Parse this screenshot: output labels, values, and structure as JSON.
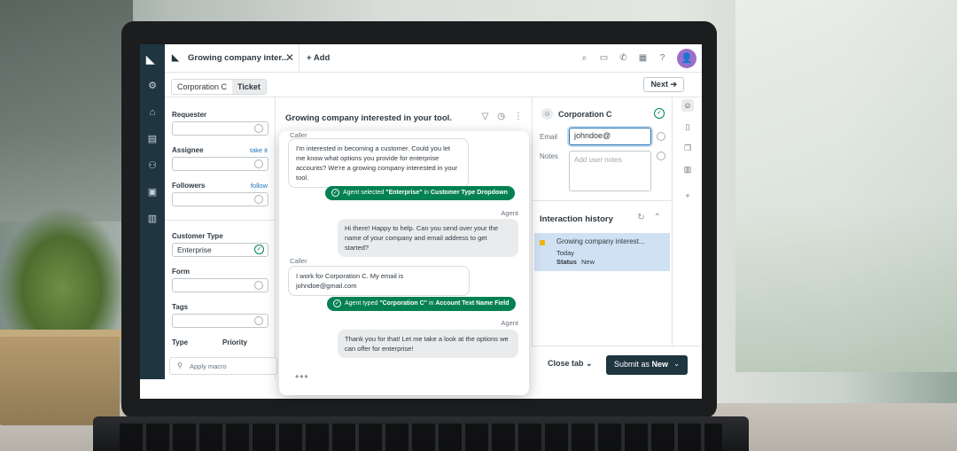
{
  "top": {
    "tab_title": "Growing company inter...",
    "add_label": "+ Add",
    "avatar_glyph": "👤"
  },
  "sub": {
    "crumbs": [
      "Corporation C",
      "Ticket"
    ],
    "next_label": "Next ➔"
  },
  "props": {
    "requester_label": "Requester",
    "assignee_label": "Assignee",
    "assignee_link": "take it",
    "followers_label": "Followers",
    "followers_link": "follow",
    "customer_type_label": "Customer Type",
    "customer_type_value": "Enterprise",
    "form_label": "Form",
    "tags_label": "Tags",
    "type_label": "Type",
    "priority_label": "Priority",
    "macro_label": "Apply macro"
  },
  "conversation": {
    "title": "Growing company interested in your tool.",
    "messages": [
      {
        "who": "Caller",
        "text": "I'm interested in becoming a customer. Could you let me know what options you provide for enterprise accounts? We're a growing company interested in your tool."
      },
      {
        "pill_prefix": "Agent selected ",
        "pill_value": "\"Enterprise\"",
        "pill_mid": " in ",
        "pill_field": "Customer Type Dropdown"
      },
      {
        "who": "Agent",
        "text": "Hi there! Happy to help. Can you send over your the name of your company and email address to get started?"
      },
      {
        "who": "Caller",
        "text": "I work for Corporation C. My email is johndoe@gmail.com"
      },
      {
        "pill_prefix": "Agent typed ",
        "pill_value": "\"Corporation C\"",
        "pill_mid": " in ",
        "pill_field": "Account Text Name Field"
      },
      {
        "who": "Agent",
        "text": "Thank you for that! Let me take a look at the options we can offer for enterprise!"
      }
    ],
    "typing": "•••"
  },
  "customer": {
    "name": "Corporation C",
    "email_label": "Email",
    "email_value": "johndoe@",
    "notes_label": "Notes",
    "notes_placeholder": "Add user notes",
    "history_title": "Interaction history",
    "history_item": {
      "title": "Growing company interest...",
      "when": "Today",
      "status_label": "Status",
      "status_value": "New"
    }
  },
  "actions": {
    "close_tab": "Close tab",
    "submit_prefix": "Submit as ",
    "submit_value": "New"
  },
  "icons": [
    "logo-icon",
    "settings-icon",
    "home-icon",
    "views-icon",
    "users-icon",
    "organizations-icon",
    "reports-icon",
    "search-icon",
    "chat-icon",
    "phone-icon",
    "apps-icon",
    "help-icon",
    "filter-icon",
    "timer-icon",
    "more-icon",
    "refresh-icon",
    "chevron-up-icon",
    "user-icon",
    "book-icon",
    "comments-icon",
    "layout-icon",
    "plus-icon"
  ],
  "colors": {
    "nav": "#1f3540",
    "accent_green": "#038153",
    "link_blue": "#1f73b7",
    "highlight": "#cfe1f3",
    "avatar": "#9b6fc9"
  }
}
